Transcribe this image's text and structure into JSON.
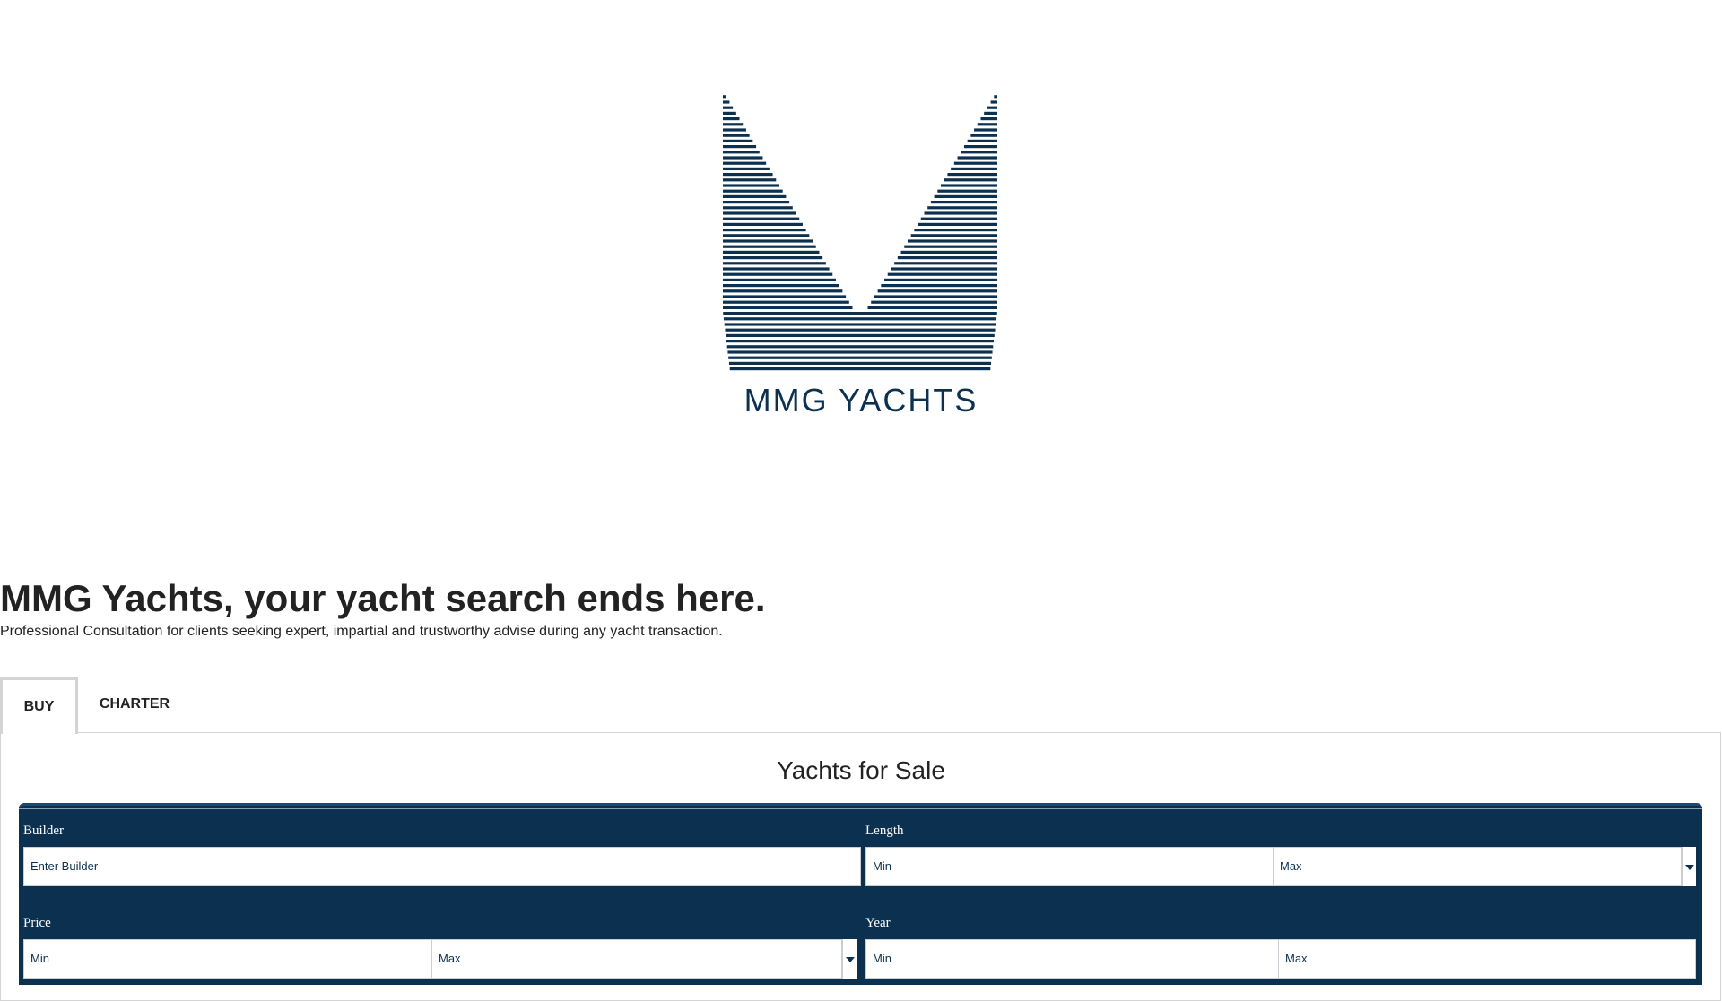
{
  "logo": {
    "text": "MMG YACHTS",
    "color": "#0c3150"
  },
  "hero": {
    "title": "MMG Yachts, your yacht search ends here.",
    "subtitle": "Professional Consultation for clients seeking expert, impartial and trustworthy advise during any yacht transaction."
  },
  "tabs": [
    {
      "label": "BUY",
      "active": true
    },
    {
      "label": "CHARTER",
      "active": false
    }
  ],
  "panel": {
    "title": "Yachts for Sale"
  },
  "search": {
    "background": "#0c3150",
    "builder": {
      "label": "Builder",
      "placeholder": "Enter Builder"
    },
    "length": {
      "label": "Length",
      "min_placeholder": "Min",
      "max_placeholder": "Max"
    },
    "price": {
      "label": "Price",
      "min_placeholder": "Min",
      "max_placeholder": "Max"
    },
    "year": {
      "label": "Year",
      "min_placeholder": "Min",
      "max_placeholder": "Max"
    }
  },
  "icons": {
    "dropdown": "chevron-down-icon"
  }
}
